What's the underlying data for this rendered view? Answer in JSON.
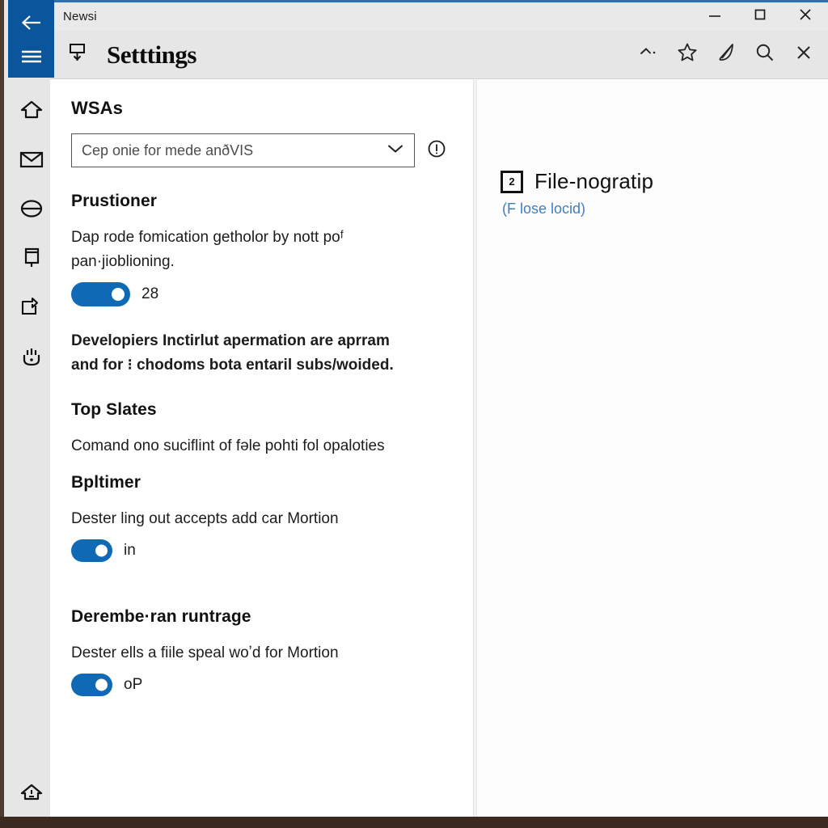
{
  "window": {
    "app_title": "Newsi",
    "controls": {
      "minimize": "minimize-icon",
      "maximize": "maximize-icon",
      "close": "close-icon"
    }
  },
  "header": {
    "title": "Setttings",
    "left_icon": "pin-download-icon",
    "actions": [
      {
        "name": "caret-up-icon",
        "glyph": "chevron-up"
      },
      {
        "name": "star-icon",
        "glyph": "star"
      },
      {
        "name": "pen-icon",
        "glyph": "pen"
      },
      {
        "name": "search-icon",
        "glyph": "magnifier"
      },
      {
        "name": "close-icon",
        "glyph": "x"
      }
    ]
  },
  "rail": {
    "back": "back-arrow-icon",
    "menu": "hamburger-menu-icon",
    "items": [
      {
        "name": "home-icon"
      },
      {
        "name": "mail-icon"
      },
      {
        "name": "block-circle-icon"
      },
      {
        "name": "tablet-icon"
      },
      {
        "name": "share-arrow-icon"
      },
      {
        "name": "hand-stop-icon"
      }
    ],
    "bottom_item": {
      "name": "home-alert-icon"
    }
  },
  "main": {
    "section_title": "WSAs",
    "combo": {
      "value": "Cep onie for mede anðVIS",
      "placeholder": "Cep onie for mede anðVIS",
      "caret": "chevron-down-icon",
      "info": "info-icon"
    },
    "sections": [
      {
        "id": "prustioner",
        "heading": "Prustioner",
        "paragraph": "Dap rode fomication getholor by nott poᶠ pan·jioblioning.",
        "toggle": {
          "state": "on",
          "label": "28"
        }
      },
      {
        "id": "developiers",
        "paragraph": "Developiers Inctirlut apermation are aprram and for ⁝ chodoms bota entaril subs/woided."
      },
      {
        "id": "top-slates",
        "heading": "Top Slates",
        "paragraph": "Comand ono suciflint of fəle pohti fol opaloties"
      },
      {
        "id": "bpltimer",
        "heading": "Bpltimer",
        "paragraph": "Dester ling out accepts add car Mortion",
        "toggle": {
          "state": "on",
          "label": "in"
        }
      },
      {
        "id": "deremberan",
        "heading": "Derembe·ran runtrage",
        "paragraph": "Dester ells a fiile speal woʼd for Mortion",
        "toggle": {
          "state": "on",
          "label": "oP"
        }
      }
    ]
  },
  "right_panel": {
    "icon": "boxed-two-icon",
    "icon_glyph": "2",
    "title": "File-nogratip",
    "subtitle": "(F lose locid)"
  },
  "colors": {
    "accent_blue": "#0a559c",
    "toggle_blue": "#1069b4",
    "link_blue": "#3f7fbf",
    "chrome_gray": "#e6e6e6",
    "titlebar_gray": "#e9e9e9"
  },
  "scrollbar": {
    "name": "vertical-scrollbar"
  }
}
